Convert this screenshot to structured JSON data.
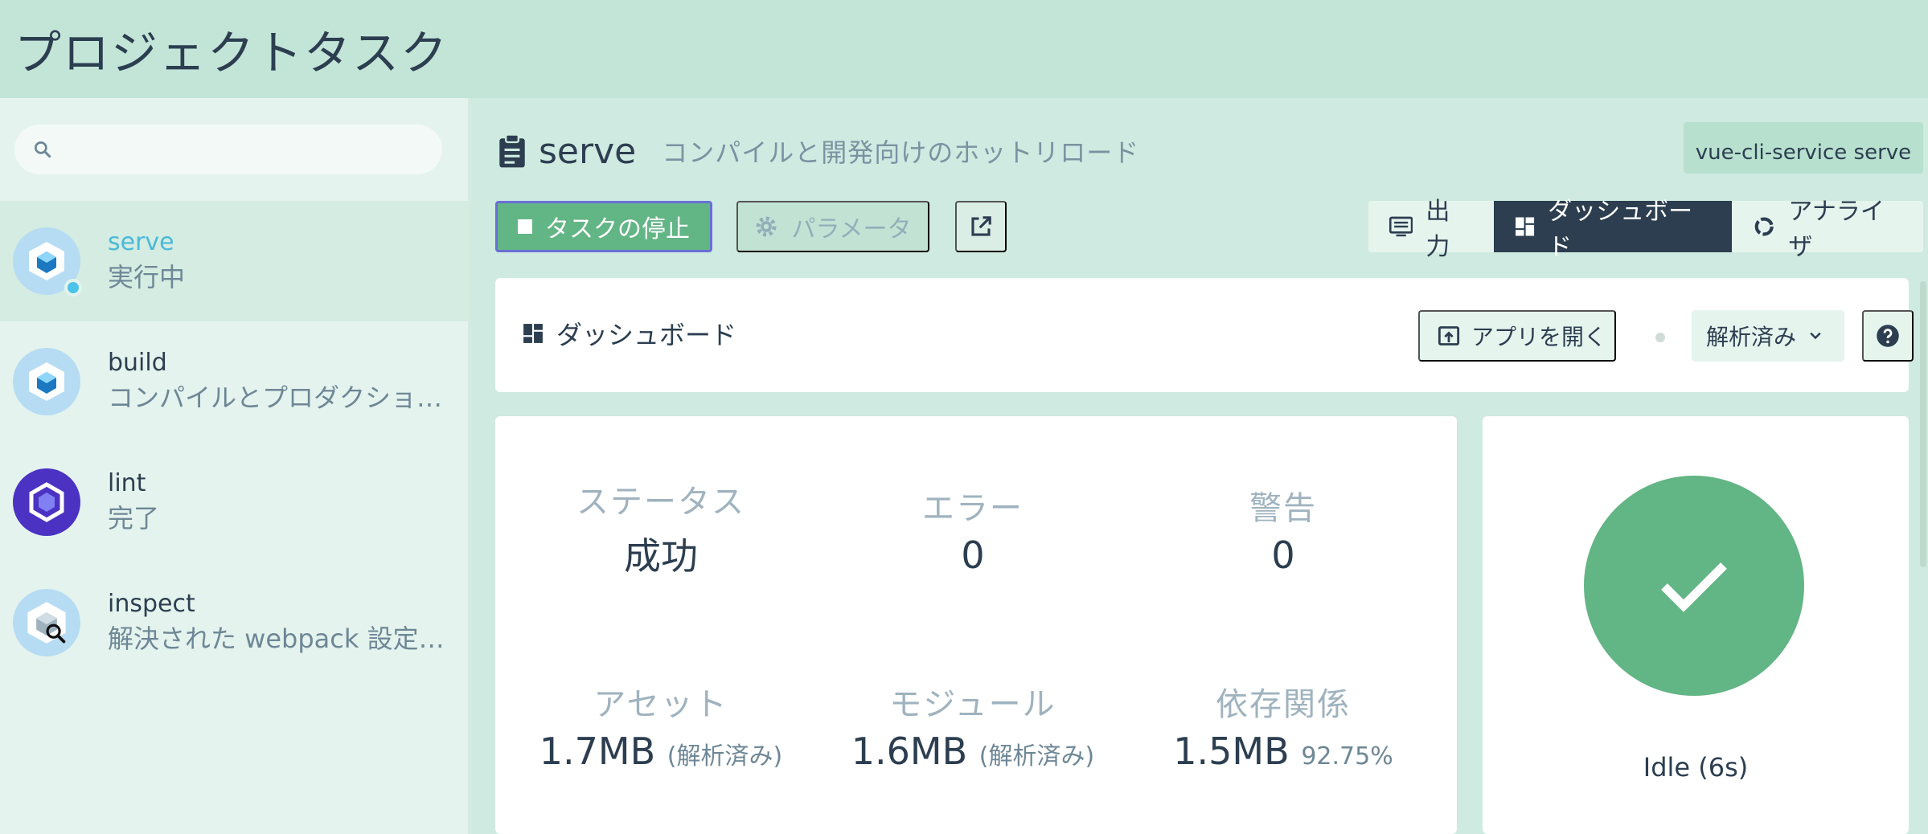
{
  "app": {
    "title": "プロジェクトタスク"
  },
  "sidebar": {
    "search": {
      "placeholder": "",
      "value": ""
    },
    "tasks": [
      {
        "name": "serve",
        "description": "実行中",
        "status": "running"
      },
      {
        "name": "build",
        "description": "コンパイルとプロダクション向けの最小化"
      },
      {
        "name": "lint",
        "description": "完了"
      },
      {
        "name": "inspect",
        "description": "解決された webpack 設定の確認"
      }
    ]
  },
  "task": {
    "name": "serve",
    "description": "コンパイルと開発向けのホットリロード",
    "command": "vue-cli-service serve"
  },
  "toolbar": {
    "stop_label": "タスクの停止",
    "params_label": "パラメータ",
    "views": {
      "output": "出力",
      "dashboard": "ダッシュボード",
      "analyzer": "アナライザ"
    },
    "active_view": "dashboard"
  },
  "dashboard": {
    "title": "ダッシュボード",
    "open_app_label": "アプリを開く",
    "mode_selected": "解析済み"
  },
  "stats": {
    "status": {
      "label": "ステータス",
      "value": "成功"
    },
    "errors": {
      "label": "エラー",
      "value": "0"
    },
    "warnings": {
      "label": "警告",
      "value": "0"
    },
    "assets": {
      "label": "アセット",
      "value": "1.7MB",
      "sub": "(解析済み)"
    },
    "modules": {
      "label": "モジュール",
      "value": "1.6MB",
      "sub": "(解析済み)"
    },
    "dependencies": {
      "label": "依存関係",
      "value": "1.5MB",
      "sub": "92.75%"
    }
  },
  "idle": {
    "label": "Idle (6s)"
  },
  "colors": {
    "accent": "#62b584",
    "dark": "#2c3e50",
    "running": "#4cc3e8"
  }
}
